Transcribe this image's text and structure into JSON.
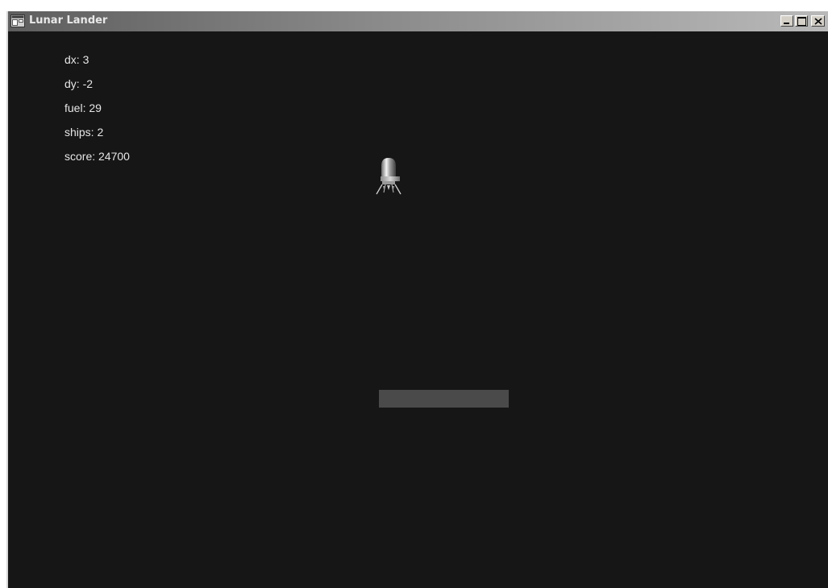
{
  "window": {
    "title": "Lunar Lander"
  },
  "hud": {
    "dx": "dx: 3",
    "dy": "dy: -2",
    "fuel": "fuel: 29",
    "ships": "ships: 2",
    "score": "score: 24700"
  },
  "icons": {
    "app": "app-window-icon",
    "minimize": "minimize-icon",
    "maximize": "maximize-icon",
    "close": "close-icon",
    "lander": "lunar-lander-ship-icon"
  },
  "colors": {
    "background": "#161616",
    "text": "#e6e6e6",
    "pad": "#4a4a4a"
  }
}
